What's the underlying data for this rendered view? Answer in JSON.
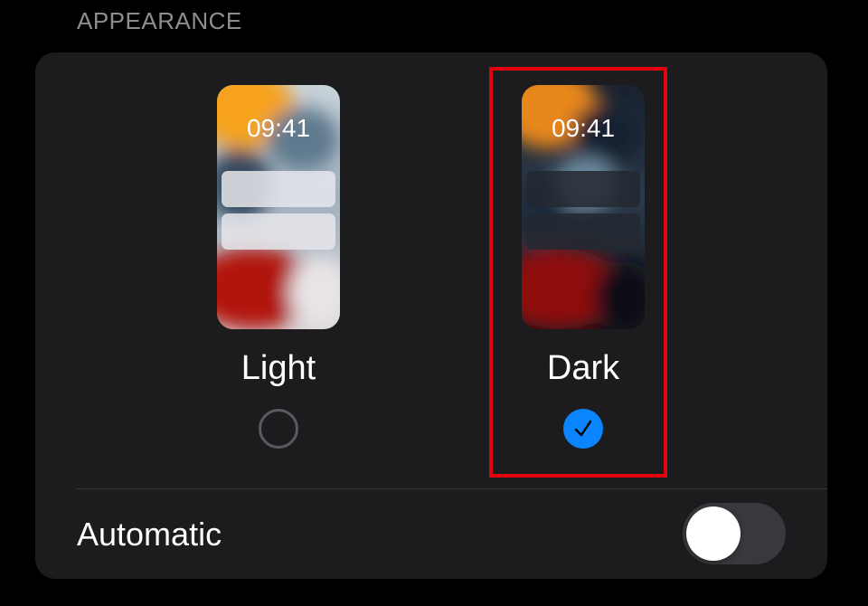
{
  "section": {
    "header": "APPEARANCE"
  },
  "options": [
    {
      "label": "Light",
      "preview_time": "09:41",
      "selected": false
    },
    {
      "label": "Dark",
      "preview_time": "09:41",
      "selected": true
    }
  ],
  "automatic": {
    "label": "Automatic",
    "enabled": false
  },
  "colors": {
    "background": "#000000",
    "card": "#1c1c1e",
    "accent": "#0a84ff",
    "highlight_border": "#e3000f",
    "toggle_off": "#39393d"
  },
  "icons": {
    "selected_radio": "checkmark-icon",
    "unselected_radio": "empty-circle-icon"
  }
}
